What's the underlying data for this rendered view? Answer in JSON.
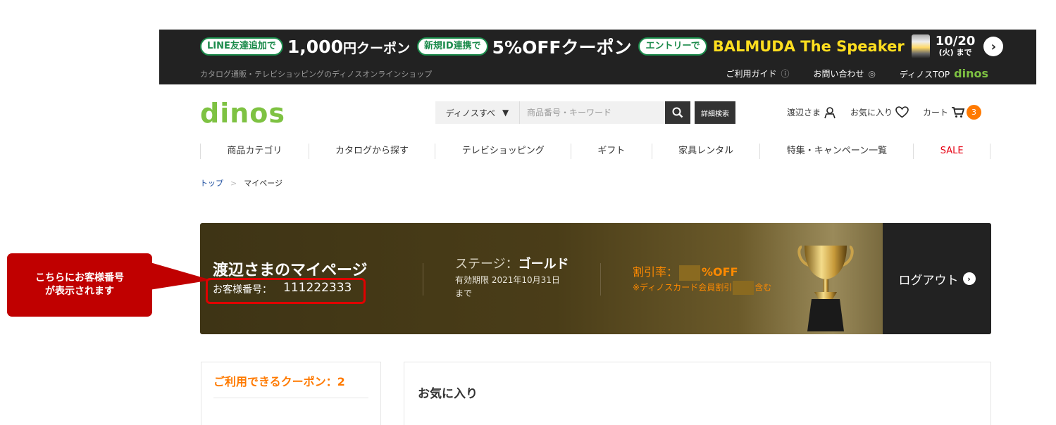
{
  "promo": {
    "pill1": "LINE友達追加で",
    "big1": "1,000",
    "big1_unit": "円クーポン",
    "pill2": "新規ID連携で",
    "big2": "5%OFFクーポン",
    "pill3": "エントリーで",
    "product": "BALMUDA The Speaker",
    "date": "10/20",
    "date_sub": "(火) まで",
    "subtitle": "カタログ通販・テレビショッピングのディノスオンラインショップ",
    "links": [
      "ご利用ガイド",
      "お問い合わせ",
      "ディノスTOP"
    ],
    "mini_logo": "dinos"
  },
  "header": {
    "logo": "dinos",
    "search_scope": "ディノスすべ",
    "search_placeholder": "商品番号・キーワード",
    "advanced_search": "詳細検索",
    "user": "渡辺さま",
    "favorites": "お気に入り",
    "cart": "カート",
    "cart_count": "3"
  },
  "nav": [
    "商品カテゴリ",
    "カタログから探す",
    "テレビショッピング",
    "ギフト",
    "家具レンタル",
    "特集・キャンペーン一覧",
    "SALE"
  ],
  "breadcrumb": {
    "home": "トップ",
    "sep": ">",
    "current": "マイページ"
  },
  "member": {
    "title": "渡辺さまのマイページ",
    "number_label": "お客様番号：",
    "number": "111222333",
    "stage_label": "ステージ：",
    "stage_value": "ゴールド",
    "expiry": "有効期限 2021年10月31日まで",
    "discount_label": "割引率：",
    "discount_suffix": "%OFF",
    "discount_note_pre": "※ディノスカード会員割引",
    "discount_note_post": "含む",
    "logout": "ログアウト"
  },
  "callout": {
    "line1": "こちらにお客様番号",
    "line2": "が表示されます"
  },
  "coupons": {
    "label": "ご利用できるクーポン：2"
  },
  "favorites_section": {
    "title": "お気に入り"
  },
  "colors": {
    "accent_green": "#7ec242",
    "orange": "#ff7a00",
    "callout_red": "#c00000",
    "sale_red": "#e60012"
  }
}
